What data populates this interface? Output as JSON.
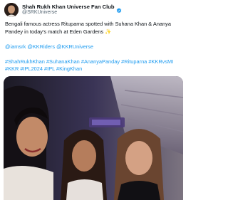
{
  "author": {
    "display_name": "Shah Rukh Khan Universe Fan Club",
    "handle": "@SRKUniverse",
    "verified": true,
    "avatar_icon": "srk-portrait-avatar",
    "verified_icon": "verified-badge-icon"
  },
  "post": {
    "text_line1": "Bengali famous actress Rituparna spotted with Suhana Khan & Ananya Pandey in today's match at Eden Gardens",
    "sparkle_emoji": "✨",
    "mentions": [
      "@iamsrk",
      "@KKRiders",
      "@KKRUniverse"
    ],
    "hashtags_line1": "#ShahRukhKhan #SuhanaKhan #AnanyaPanday #Rituparna #KKRvsMI",
    "hashtags_line2": "#KKR #IPL2024 #IPL #KingKhan"
  },
  "colors": {
    "link": "#1d9bf0",
    "text": "#0f1419",
    "secondary": "#536471",
    "verified": "#1d9bf0"
  }
}
